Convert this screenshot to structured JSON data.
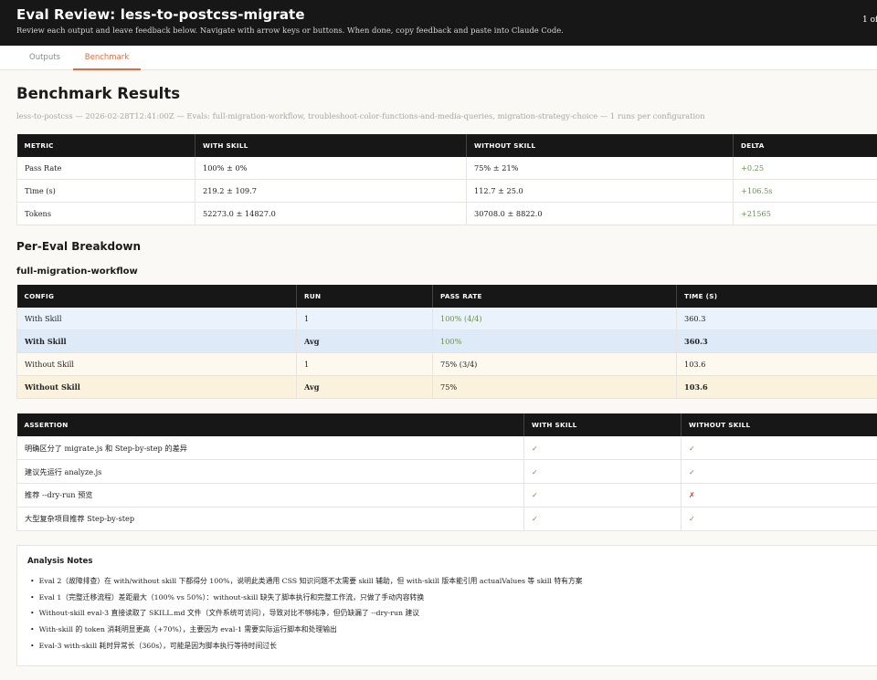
{
  "header": {
    "title": "Eval Review: less-to-postcss-migrate",
    "subtitle": "Review each output and leave feedback below. Navigate with arrow keys or buttons. When done, copy feedback and paste into Claude Code.",
    "counter": "1 of"
  },
  "tabs": [
    {
      "label": "Outputs"
    },
    {
      "label": "Benchmark"
    }
  ],
  "page": {
    "title": "Benchmark Results",
    "meta": "less-to-postcss — 2026-02-28T12:41:00Z — Evals: full-migration-workflow, troubleshoot-color-functions-and-media-queries, migration-strategy-choice — 1 runs per configuration"
  },
  "summary": {
    "headers": [
      "METRIC",
      "WITH SKILL",
      "WITHOUT SKILL",
      "DELTA"
    ],
    "rows": [
      [
        "Pass Rate",
        "100% ± 0%",
        "75% ± 21%",
        "+0.25"
      ],
      [
        "Time (s)",
        "219.2 ± 109.7",
        "112.7 ± 25.0",
        "+106.5s"
      ],
      [
        "Tokens",
        "52273.0 ± 14827.0",
        "30708.0 ± 8822.0",
        "+21565"
      ]
    ]
  },
  "breakdown": {
    "title": "Per-Eval Breakdown",
    "eval_name": "full-migration-workflow",
    "headers": [
      "CONFIG",
      "RUN",
      "PASS RATE",
      "TIME (S)"
    ],
    "rows": [
      [
        "With Skill",
        "1",
        "100% (4/4)",
        "360.3"
      ],
      [
        "With Skill",
        "Avg",
        "100%",
        "360.3"
      ],
      [
        "Without Skill",
        "1",
        "75% (3/4)",
        "103.6"
      ],
      [
        "Without Skill",
        "Avg",
        "75%",
        "103.6"
      ]
    ]
  },
  "assertions": {
    "headers": [
      "ASSERTION",
      "WITH SKILL",
      "WITHOUT SKILL"
    ],
    "rows": [
      [
        "明确区分了 migrate.js 和 Step-by-step 的差异",
        "✓",
        "✓"
      ],
      [
        "建议先运行 analyze.js",
        "✓",
        "✓"
      ],
      [
        "推荐 --dry-run 预览",
        "✓",
        "✗"
      ],
      [
        "大型复杂项目推荐 Step-by-step",
        "✓",
        "✓"
      ]
    ]
  },
  "notes": {
    "title": "Analysis Notes",
    "items": [
      "Eval 2（故障排查）在 with/without skill 下都得分 100%，说明此类通用 CSS 知识问题不太需要 skill 辅助，但 with-skill 版本能引用 actualValues 等 skill 特有方案",
      "Eval 1（完整迁移流程）差距最大（100% vs 50%）：without-skill 缺失了脚本执行和完整工作流，只做了手动内容转换",
      "Without-skill eval-3 直接读取了 SKILL.md 文件（文件系统可访问），导致对比不够纯净，但仍缺漏了 --dry-run 建议",
      "With-skill 的 token 消耗明显更高（+70%），主要因为 eval-1 需要实际运行脚本和处理输出",
      "Eval-3 with-skill 耗时异常长（360s），可能是因为脚本执行等待时间过长"
    ]
  },
  "colors": {
    "accent": "#d86f42",
    "header_bg": "#171717",
    "positive": "#6b8f4e",
    "negative": "#c0392b",
    "with_skill_row": "#eaf2fb",
    "without_skill_row": "#fdf9ef"
  }
}
